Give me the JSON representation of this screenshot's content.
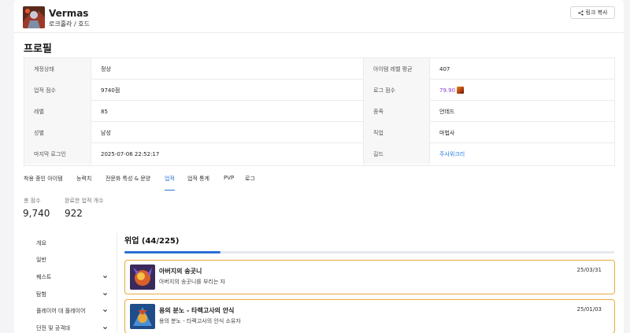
{
  "header": {
    "character_name": "Vermas",
    "server_class": "로크홀라 / 호드",
    "share_label": "링크 복사"
  },
  "profile": {
    "title": "프로필",
    "rows": [
      {
        "label1": "계정상태",
        "value1": "정상",
        "label2": "아이템 레벨 평균",
        "value2": "407"
      },
      {
        "label1": "업적 점수",
        "value1": "9740점",
        "label2": "로그 점수",
        "value2": "79.90"
      },
      {
        "label1": "레벨",
        "value1": "85",
        "label2": "종족",
        "value2": "언데드"
      },
      {
        "label1": "성별",
        "value1": "남성",
        "label2": "직업",
        "value2": "마법사"
      },
      {
        "label1": "마지막 로그인",
        "value1": "2025-07-06 22:52:17",
        "label2": "길드",
        "value2": "주사위크리"
      }
    ]
  },
  "tabs": [
    "착용 중인 아이템",
    "능력치",
    "전문화 특성 & 문양",
    "업적",
    "업적 통계",
    "PVP",
    "로그"
  ],
  "active_tab": "업적",
  "stats": {
    "total_label": "총 점수",
    "total_value": "9,740",
    "done_label": "완료한 업적 개수",
    "done_value": "922"
  },
  "sidebar": [
    {
      "label": "개요",
      "expandable": false
    },
    {
      "label": "일반",
      "expandable": false
    },
    {
      "label": "퀘스트",
      "expandable": true
    },
    {
      "label": "탐험",
      "expandable": true
    },
    {
      "label": "플레이어 대 플레이어",
      "expandable": true
    },
    {
      "label": "던전 및 공격대",
      "expandable": true
    }
  ],
  "category": {
    "title": "위업 (44/225)",
    "progress_fraction": 0.1956
  },
  "achievements": [
    {
      "title": "아버지의 송곳니",
      "desc": "아버지의 송곳니를 부리는 자",
      "date": "25/03/31"
    },
    {
      "title": "용의 분노 - 타렉고사의 안식",
      "desc": "용의 분노 - 타렉고사의 안식 소유자",
      "date": "25/01/03"
    }
  ],
  "colors": {
    "accent": "#2a6fd6",
    "achievement_border": "#e8a93a",
    "log_score": "#8a3ec7",
    "guild_link": "#2a7de1"
  }
}
